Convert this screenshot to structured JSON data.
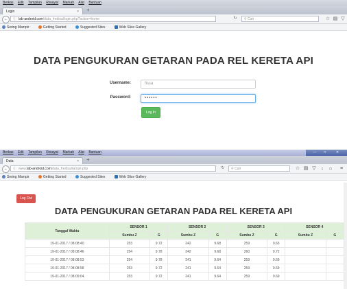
{
  "window1": {
    "menu": [
      "Berkas",
      "Edit",
      "Tampilan",
      "Riwayat",
      "Markah",
      "Alat",
      "Bantuan"
    ],
    "tab_title": "Login",
    "tab_close": "×",
    "new_tab": "+",
    "url_host": "lab-android.com",
    "url_path": "/data_fredisa/login.php?action=home",
    "search_placeholder": "Cari",
    "bookmarks": [
      "Sering Mampir",
      "Getting Started",
      "Suggested Sites",
      "Web Slice Gallery"
    ],
    "heading": "DATA PENGUKURAN GETARAN PADA REL KERETA API",
    "username_label": "Username:",
    "username_value": "fissa",
    "password_label": "Password:",
    "password_value": "••••••",
    "login_button": "Log In"
  },
  "window2": {
    "menu": [
      "Berkas",
      "Edit",
      "Tampilan",
      "Riwayat",
      "Markah",
      "Alat",
      "Bantuan"
    ],
    "tab_title": "Data",
    "tab_close": "×",
    "new_tab": "+",
    "url_prefix": "www.",
    "url_host": "lab-android.com",
    "url_path": "/data_fredisa/tampil.php",
    "search_placeholder": "Cari",
    "bookmarks": [
      "Sering Mampir",
      "Getting Started",
      "Suggested Sites",
      "Web Slice Gallery"
    ],
    "logout_button": "Log Out",
    "heading": "DATA PENGUKURAN GETARAN PADA REL KERETA API",
    "table": {
      "col_waktu": "Tanggal Waktu",
      "sensors": [
        "SENSOR 1",
        "SENSOR 2",
        "SENSOR 3",
        "SENSOR 4"
      ],
      "sub_sumbu": "Sumbu Z",
      "sub_g": "G",
      "rows": [
        [
          "19-01-2017 / 08:08:40",
          "253",
          "9.72",
          "242",
          "9.68",
          "259",
          "9.65",
          "",
          ""
        ],
        [
          "19-01-2017 / 08:08:46",
          "254",
          "9.78",
          "242",
          "9.68",
          "260",
          "9.72",
          "",
          ""
        ],
        [
          "19-01-2017 / 08:08:53",
          "254",
          "9.78",
          "241",
          "9.64",
          "259",
          "9.69",
          "",
          ""
        ],
        [
          "19-01-2017 / 08:08:58",
          "253",
          "9.72",
          "241",
          "9.64",
          "259",
          "9.69",
          "",
          ""
        ],
        [
          "19-01-2017 / 08:09:04",
          "253",
          "9.72",
          "241",
          "9.64",
          "259",
          "9.69",
          "",
          ""
        ]
      ]
    }
  },
  "icons": [
    "back-icon",
    "info-icon",
    "reload-icon",
    "search-icon",
    "star-icon",
    "bookmark-list-icon",
    "pocket-icon",
    "download-icon",
    "home-icon",
    "menu-icon"
  ],
  "colors": {
    "login_green": "#5cb85c",
    "logout_red": "#d9534f",
    "table_header": "#dff0d8",
    "focus_blue": "#66afe9"
  }
}
